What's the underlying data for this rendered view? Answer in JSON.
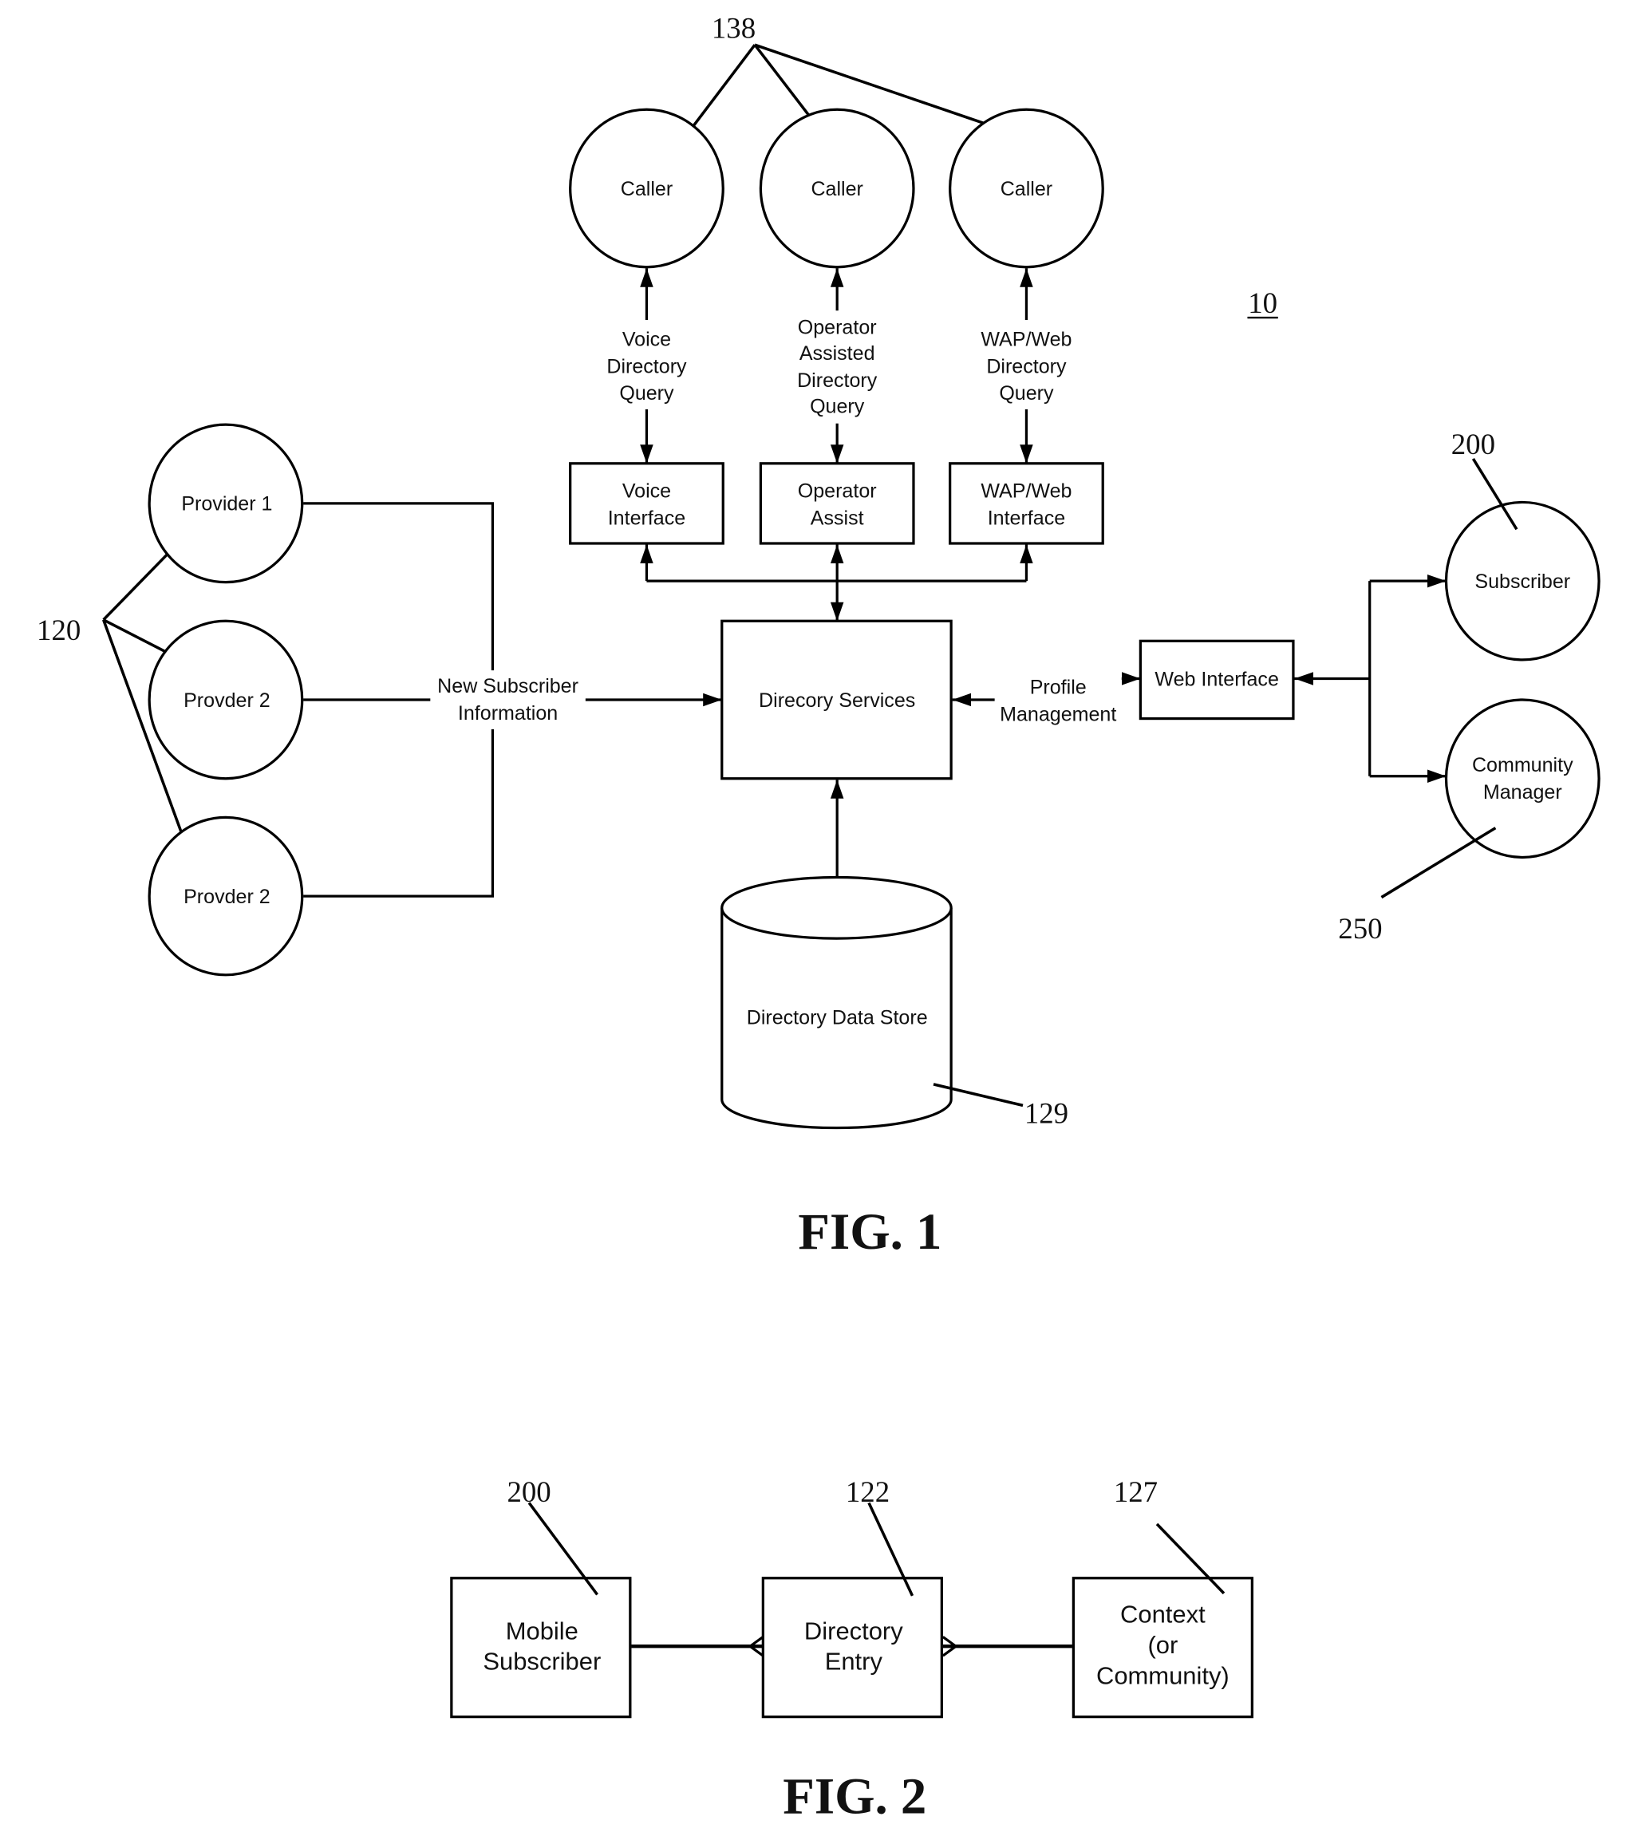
{
  "figure1": {
    "title": "FIG. 1",
    "system_ref": "10",
    "callers": {
      "ref": "138",
      "items": [
        {
          "label": "Caller",
          "channel": [
            "Voice",
            "Directory",
            "Query"
          ],
          "interface": [
            "Voice",
            "Interface"
          ]
        },
        {
          "label": "Caller",
          "channel": [
            "Operator",
            "Assisted",
            "Directory",
            "Query"
          ],
          "interface": [
            "Operator",
            "Assist"
          ]
        },
        {
          "label": "Caller",
          "channel": [
            "WAP/Web",
            "Directory",
            "Query"
          ],
          "interface": [
            "WAP/Web",
            "Interface"
          ]
        }
      ]
    },
    "providers": {
      "ref": "120",
      "items": [
        "Provider 1",
        "Provder 2",
        "Provder 2"
      ],
      "flow_label": [
        "New Subscriber",
        "Information"
      ]
    },
    "directory_services": "Direcory Services",
    "data_store": {
      "label": "Directory Data Store",
      "ref": "129"
    },
    "profile_management": [
      "Profile",
      "Management"
    ],
    "web_interface": "Web Interface",
    "subscriber": {
      "label": "Subscriber",
      "ref": "200"
    },
    "community_manager": {
      "label": [
        "Community",
        "Manager"
      ],
      "ref": "250"
    }
  },
  "figure2": {
    "title": "FIG. 2",
    "boxes": [
      {
        "label": [
          "Mobile",
          "Subscriber"
        ],
        "ref": "200"
      },
      {
        "label": [
          "Directory",
          "Entry"
        ],
        "ref": "122"
      },
      {
        "label": [
          "Context",
          "(or",
          "Community)"
        ],
        "ref": "127"
      }
    ]
  }
}
